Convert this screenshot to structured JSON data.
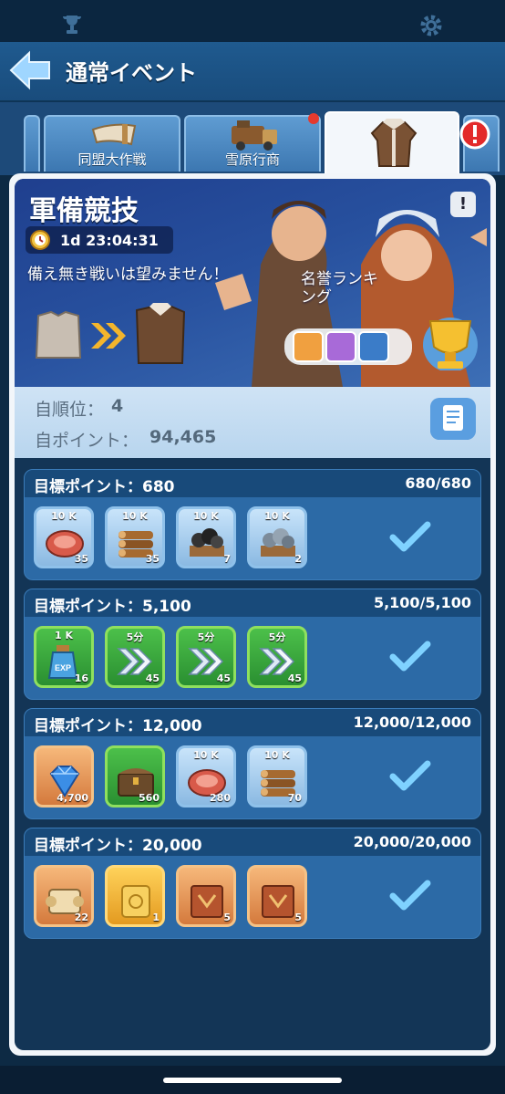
{
  "header": {
    "title": "通常イベント"
  },
  "tabs": [
    {
      "label": "同盟大作戦"
    },
    {
      "label": "雪原行商"
    },
    {
      "label": ""
    }
  ],
  "event": {
    "title": "軍備競技",
    "timer": "1d 23:04:31",
    "tagline": "備え無き戦いは望みません！",
    "ranking_label": "名誉ランキング",
    "info_icon": "!"
  },
  "stats": {
    "rank_label": "自順位：",
    "rank_value": "4",
    "points_label": "自ポイント：",
    "points_value": "94,465"
  },
  "goals": [
    {
      "label": "目標ポイント：680",
      "progress": "680/680",
      "items": [
        {
          "top": "10 K",
          "count": "35",
          "kind": "meat",
          "style": "blue"
        },
        {
          "top": "10 K",
          "count": "35",
          "kind": "wood",
          "style": "blue"
        },
        {
          "top": "10 K",
          "count": "7",
          "kind": "coal",
          "style": "blue"
        },
        {
          "top": "10 K",
          "count": "2",
          "kind": "iron",
          "style": "blue"
        }
      ]
    },
    {
      "label": "目標ポイント：5,100",
      "progress": "5,100/5,100",
      "items": [
        {
          "top": "1 K",
          "count": "16",
          "kind": "exp",
          "style": "green"
        },
        {
          "top": "5分",
          "count": "45",
          "kind": "speed",
          "style": "green"
        },
        {
          "top": "5分",
          "count": "45",
          "kind": "speed",
          "style": "green"
        },
        {
          "top": "5分",
          "count": "45",
          "kind": "speed",
          "style": "green"
        }
      ]
    },
    {
      "label": "目標ポイント：12,000",
      "progress": "12,000/12,000",
      "items": [
        {
          "top": "",
          "count": "4,700",
          "kind": "gem",
          "style": "orange"
        },
        {
          "top": "",
          "count": "560",
          "kind": "chest",
          "style": "green"
        },
        {
          "top": "10 K",
          "count": "280",
          "kind": "meat",
          "style": "blue"
        },
        {
          "top": "10 K",
          "count": "70",
          "kind": "wood",
          "style": "blue"
        }
      ]
    },
    {
      "label": "目標ポイント：20,000",
      "progress": "20,000/20,000",
      "items": [
        {
          "top": "",
          "count": "22",
          "kind": "scroll",
          "style": "orange"
        },
        {
          "top": "",
          "count": "1",
          "kind": "ticket",
          "style": "gold"
        },
        {
          "top": "",
          "count": "5",
          "kind": "book",
          "style": "orange"
        },
        {
          "top": "",
          "count": "5",
          "kind": "book",
          "style": "orange"
        }
      ]
    }
  ]
}
